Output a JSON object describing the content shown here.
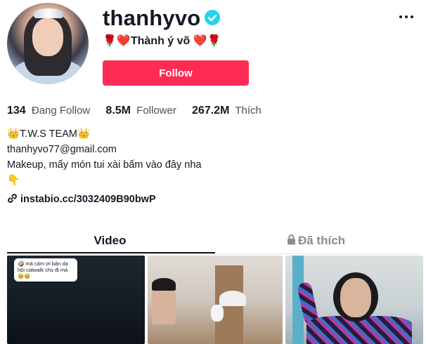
{
  "profile": {
    "username": "thanhyvo",
    "nickname": "🌹❤️Thành ý võ ❤️🌹",
    "follow_label": "Follow"
  },
  "stats": [
    {
      "value": "134",
      "label": "Đang Follow"
    },
    {
      "value": "8.5M",
      "label": "Follower"
    },
    {
      "value": "267.2M",
      "label": "Thích"
    }
  ],
  "bio": {
    "line1": "👑T.W.S TEAM👑",
    "line2": "thanhyvo77@gmail.com",
    "line3": "Makeup, mấy món tui xài bấm vào đây nha",
    "line4": "👇"
  },
  "link": {
    "text": "instabio.cc/3032409B90bwP"
  },
  "tabs": {
    "video": "Video",
    "liked": "Đã thích"
  },
  "videos": [
    {
      "caption": "🥥 má cảm ơi bận dạ hội catwalk chs đi má🥹🥹"
    },
    {
      "caption": ""
    },
    {
      "caption": ""
    }
  ],
  "colors": {
    "follow_button": "#fe2c55",
    "verified_badge": "#20d5ec",
    "text_primary": "#161823",
    "text_secondary": "#4d4e58"
  },
  "icons": {
    "verified": "verified-badge-icon",
    "more": "more-options-icon",
    "link": "link-chain-icon",
    "lock": "lock-icon"
  }
}
